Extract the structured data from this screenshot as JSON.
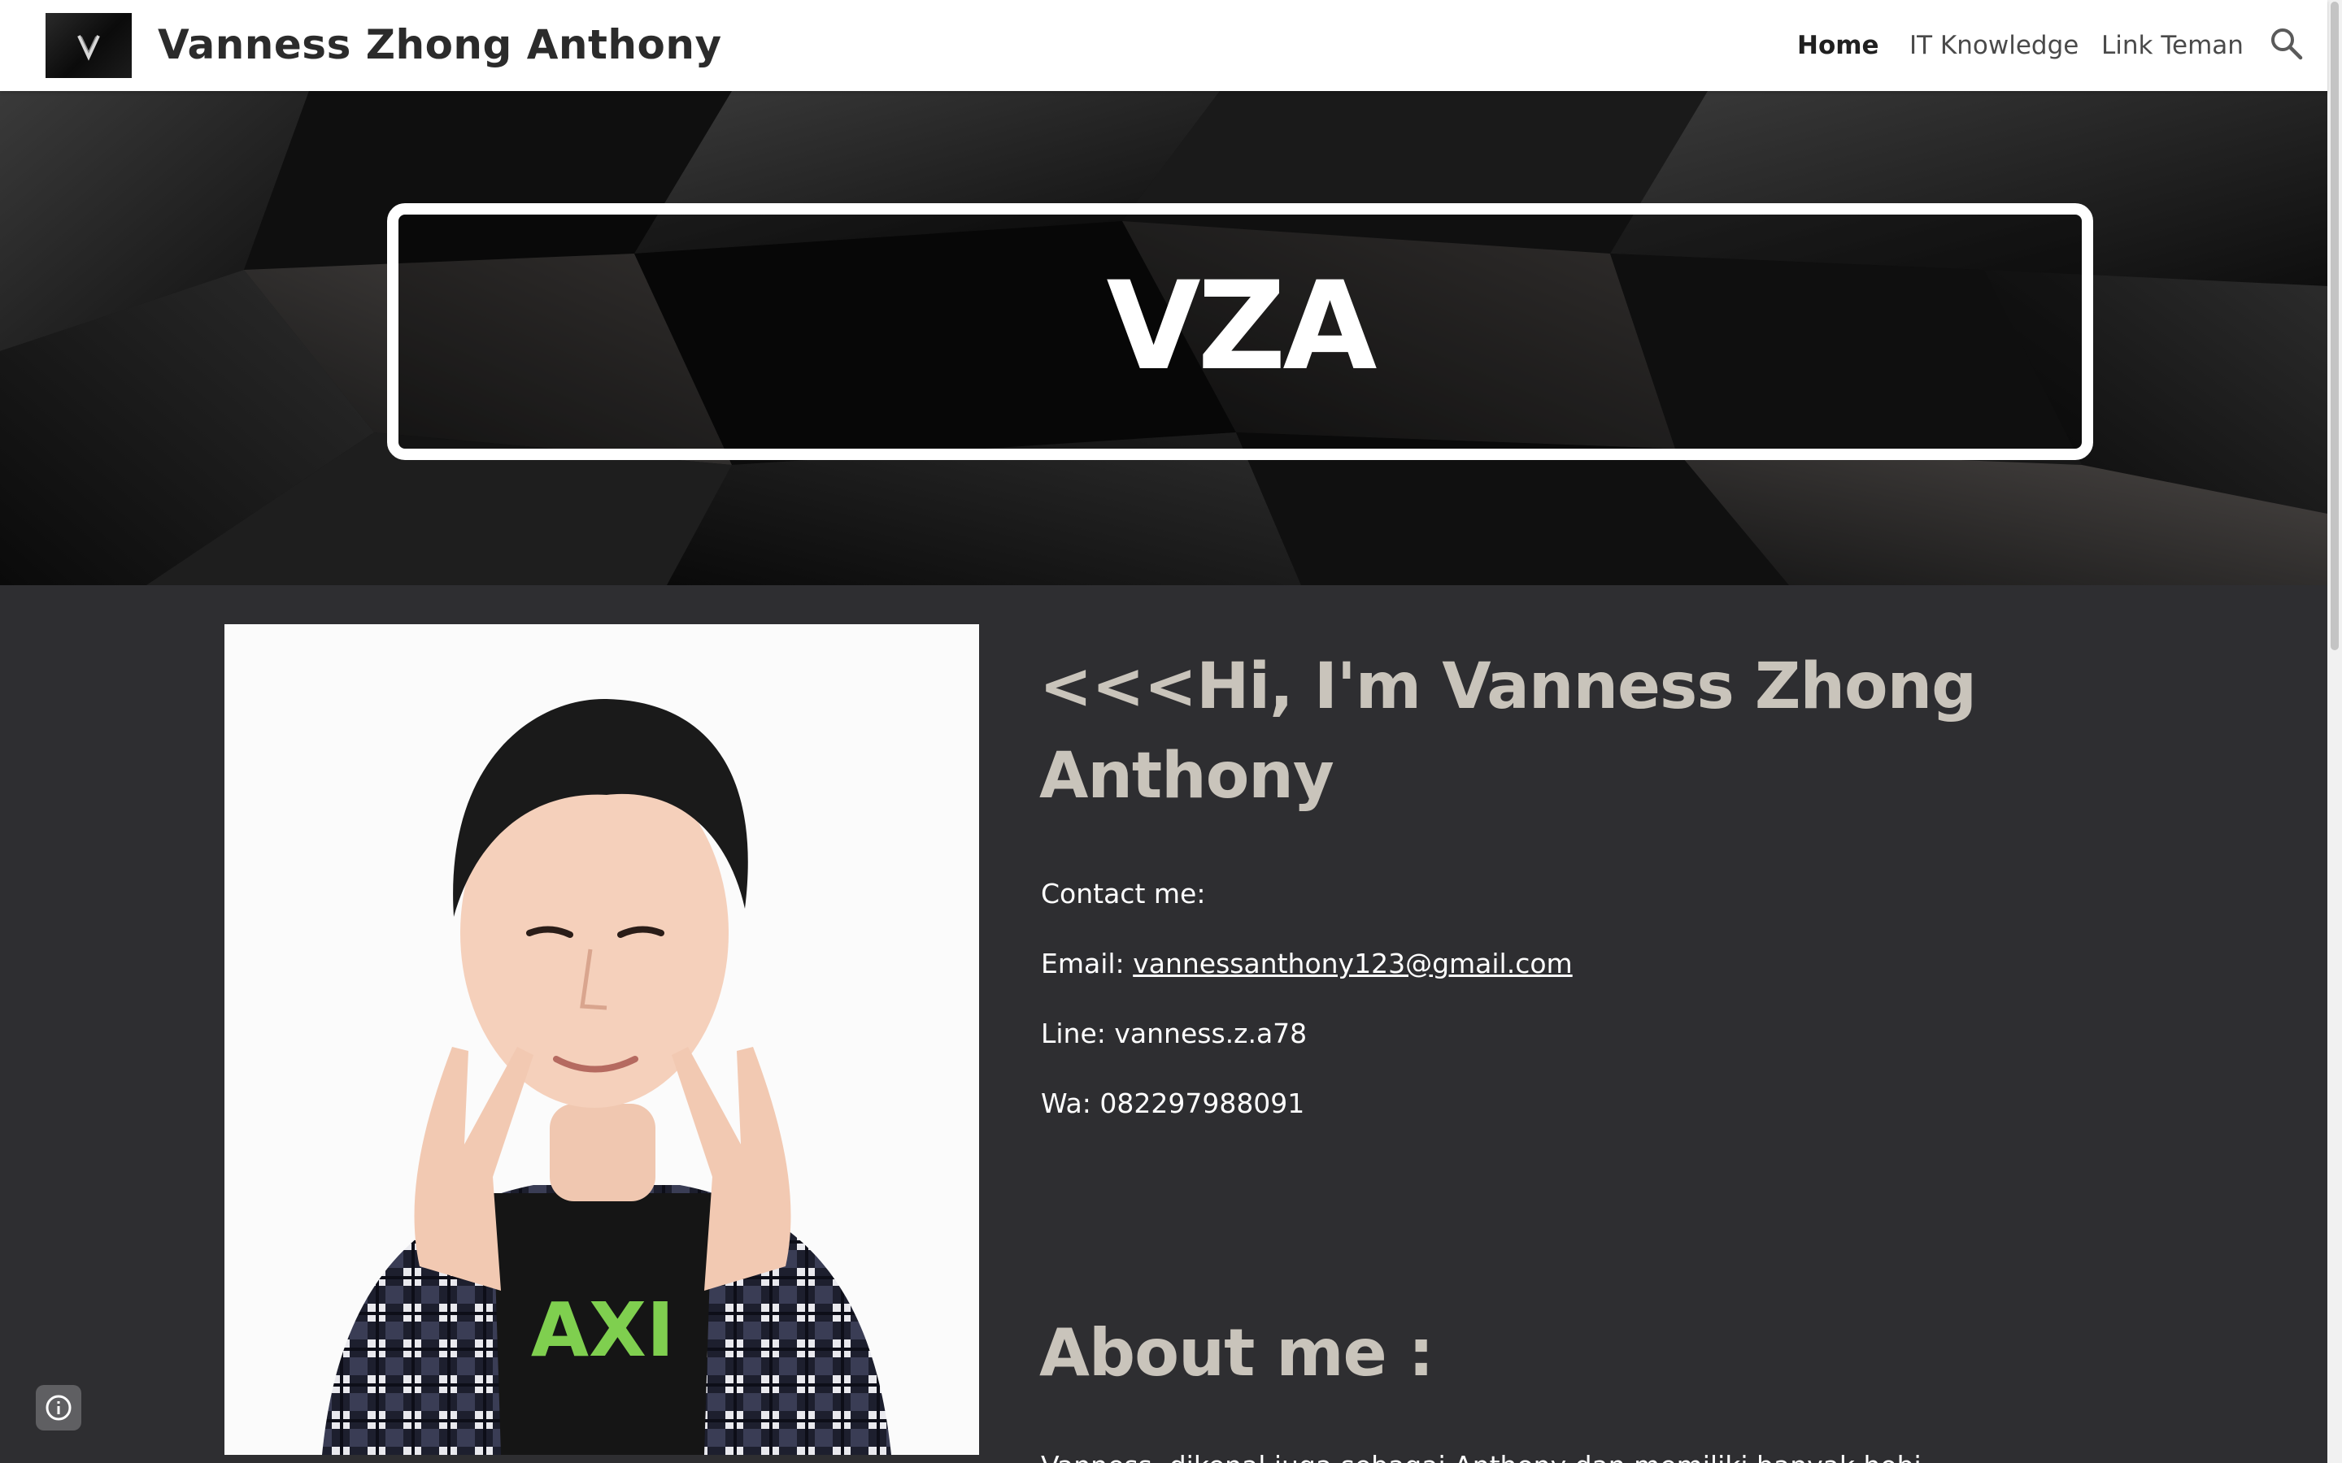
{
  "header": {
    "site_title": "Vanness Zhong Anthony",
    "nav": [
      {
        "label": "Home",
        "active": true
      },
      {
        "label": "IT Knowledge",
        "active": false
      },
      {
        "label": "Link Teman",
        "active": false
      }
    ],
    "search_icon": "search-icon",
    "logo_letter": "V"
  },
  "hero": {
    "title": "VZA"
  },
  "main": {
    "greeting": "<<<Hi, I'm Vanness Zhong Anthony",
    "contact_heading": "Contact me:",
    "email_label": "Email:",
    "email_value": "vannessanthony123@gmail.com",
    "line": "Line: vanness.z.a78",
    "wa": "Wa: 082297988091",
    "about_heading": "About me :",
    "about_text": "Vanness, dikenal juga sebagai Anthony dan memiliki banyak hobi.",
    "photo_shirt_text": "AXI"
  },
  "colors": {
    "header_bg": "#ffffff",
    "content_bg": "#2e2e31",
    "heading": "#c9c4bb",
    "text": "#ffffff"
  }
}
